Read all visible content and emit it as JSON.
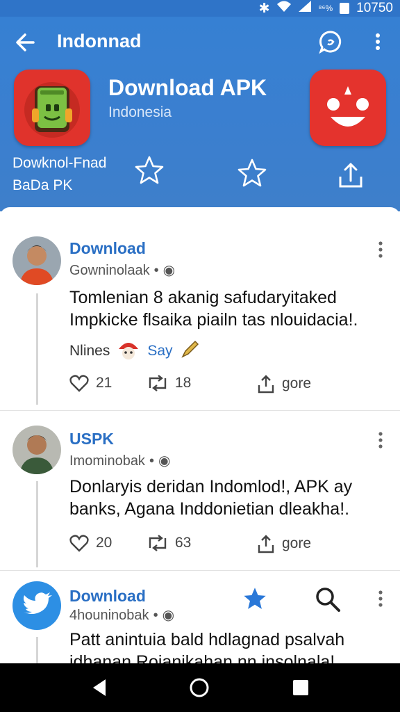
{
  "status_bar": {
    "signal_label": "⁸⁶%",
    "time": "10750"
  },
  "toolbar": {
    "title": "Indonnad"
  },
  "app": {
    "title": "Download APK",
    "subtitle": "Indonesia",
    "promo_line1": "Dowknol-Fnad",
    "promo_line2": "BaDa PK"
  },
  "posts": [
    {
      "name": "Download",
      "handle": "Gowninolaak",
      "text": "Tomlenian 8 akanig safudaryitaked Impkicke flsaika piailn tas nlouidacia!.",
      "extra_left": "Nlines",
      "extra_say": "Say",
      "likes": "21",
      "reposts": "18",
      "share_label": "gore"
    },
    {
      "name": "USPK",
      "handle": "Imominobak",
      "text": "Donlaryis deridan Indomlod!, APK ay banks, Agana Inddonietian dleakha!.",
      "likes": "20",
      "reposts": "63",
      "share_label": "gore"
    },
    {
      "name": "Download",
      "handle": "4houninobak",
      "text": "Patt anintuia bald hdlagnad psalvah idhanan Rojanikahan nn insolnala!"
    }
  ],
  "colors": {
    "header_blue": "#3680d3",
    "link_blue": "#2a6fc4",
    "icon_red": "#e0332c"
  }
}
